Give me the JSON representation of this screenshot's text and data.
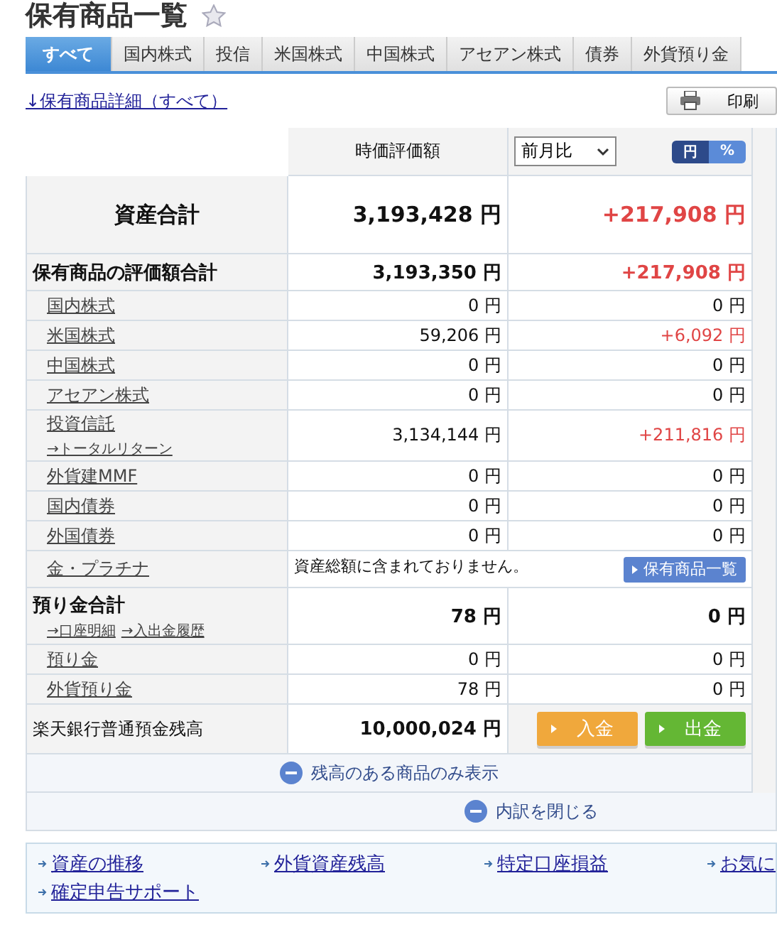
{
  "title": "保有商品一覧",
  "tabs": [
    {
      "label": "すべて",
      "selected": true
    },
    {
      "label": "国内株式",
      "selected": false
    },
    {
      "label": "投信",
      "selected": false
    },
    {
      "label": "米国株式",
      "selected": false
    },
    {
      "label": "中国株式",
      "selected": false
    },
    {
      "label": "アセアン株式",
      "selected": false
    },
    {
      "label": "債券",
      "selected": false
    },
    {
      "label": "外貨預り金",
      "selected": false
    }
  ],
  "detail_link": "↓保有商品詳細（すべて）",
  "print_button": "印刷",
  "header": {
    "value_column": "時価評価額",
    "change_select": "前月比",
    "unit_toggle": [
      {
        "label": "円",
        "selected": true
      },
      {
        "label": "%",
        "selected": false
      }
    ]
  },
  "asset_total": {
    "label": "資産合計",
    "value": "3,193,428 円",
    "change": "+217,908 円",
    "color": "#e04545"
  },
  "rows": [
    {
      "kind": "group",
      "label": "保有商品の評価額合計",
      "value": "3,193,350 円",
      "change": "+217,908 円",
      "color": "#e04545"
    },
    {
      "kind": "item",
      "label": "国内株式",
      "value": "0 円",
      "change": "0 円"
    },
    {
      "kind": "item",
      "label": "米国株式",
      "value": "59,206 円",
      "change": "+6,092 円",
      "color": "#e04545"
    },
    {
      "kind": "item",
      "label": "中国株式",
      "value": "0 円",
      "change": "0 円"
    },
    {
      "kind": "item",
      "label": "アセアン株式",
      "value": "0 円",
      "change": "0 円"
    },
    {
      "kind": "item",
      "label": "投資信託",
      "sublinks": [
        "→トータルリターン"
      ],
      "value": "3,134,144 円",
      "change": "+211,816 円",
      "color": "#e04545"
    },
    {
      "kind": "item",
      "label": "外貨建MMF",
      "value": "0 円",
      "change": "0 円"
    },
    {
      "kind": "item",
      "label": "国内債券",
      "value": "0 円",
      "change": "0 円"
    },
    {
      "kind": "item",
      "label": "外国債券",
      "value": "0 円",
      "change": "0 円"
    },
    {
      "kind": "note",
      "label": "金・プラチナ",
      "note": "資産総額に含まれておりません。",
      "button": "保有商品一覧"
    },
    {
      "kind": "group",
      "label": "預り金合計",
      "sublinks": [
        "→口座明細",
        "→入出金履歴"
      ],
      "value": "78 円",
      "change": "0 円"
    },
    {
      "kind": "item",
      "label": "預り金",
      "value": "0 円",
      "change": "0 円"
    },
    {
      "kind": "item",
      "label": "外貨預り金",
      "value": "78 円",
      "change": "0 円"
    },
    {
      "kind": "bank",
      "label": "楽天銀行普通預金残高",
      "value": "10,000,024 円",
      "buttons": [
        {
          "label": "入金",
          "kind": "deposit"
        },
        {
          "label": "出金",
          "kind": "withdraw"
        }
      ]
    }
  ],
  "show_only_toggle": "残高のある商品のみ表示",
  "close_toggle": "内訳を閉じる",
  "footer_links": [
    {
      "label": "資産の推移"
    },
    {
      "label": "外貨資産残高"
    },
    {
      "label": "特定口座損益"
    },
    {
      "label": "お気に"
    },
    {
      "label": "確定申告サポート"
    }
  ]
}
